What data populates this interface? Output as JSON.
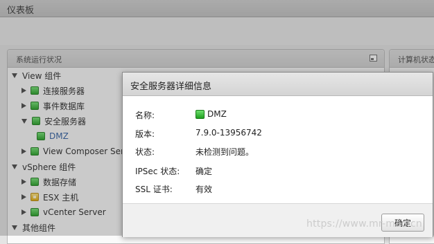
{
  "page": {
    "title": "仪表板"
  },
  "left_panel": {
    "title": "系统运行状况",
    "tree": [
      {
        "label": "View 组件",
        "level": 0,
        "expander": "down",
        "icon": null
      },
      {
        "label": "连接服务器",
        "level": 1,
        "expander": "right",
        "icon": "green-status-icon"
      },
      {
        "label": "事件数据库",
        "level": 1,
        "expander": "right",
        "icon": "green-status-icon"
      },
      {
        "label": "安全服务器",
        "level": 1,
        "expander": "down",
        "icon": "green-status-icon"
      },
      {
        "label": "DMZ",
        "level": 2,
        "expander": null,
        "icon": "green-status-icon"
      },
      {
        "label": "View Composer Serv",
        "level": 1,
        "expander": "right",
        "icon": "green-status-icon"
      },
      {
        "label": "vSphere 组件",
        "level": 0,
        "expander": "down",
        "icon": null
      },
      {
        "label": "数据存储",
        "level": 1,
        "expander": "right",
        "icon": "green-status-icon"
      },
      {
        "label": "ESX 主机",
        "level": 1,
        "expander": "right",
        "icon": "yellow-status-icon"
      },
      {
        "label": "vCenter Server",
        "level": 1,
        "expander": "right",
        "icon": "green-status-icon"
      },
      {
        "label": "其他组件",
        "level": 0,
        "expander": "down",
        "icon": null
      }
    ]
  },
  "right_panel": {
    "title": "计算机状态"
  },
  "modal": {
    "title": "安全服务器详细信息",
    "fields": {
      "name_label": "名称:",
      "name_value": "DMZ",
      "version_label": "版本:",
      "version_value": "7.9.0-13956742",
      "status_label": "状态:",
      "status_value": "未检测到问题。",
      "ipsec_label": "IPSec 状态:",
      "ipsec_value": "确定",
      "ssl_label": "SSL 证书:",
      "ssl_value": "有效"
    },
    "ok_label": "确定"
  },
  "watermark": "https://www.mr-mao.cn",
  "colors": {
    "status_green": "#2fb52f",
    "status_yellow": "#f0b400",
    "link": "#2a5aa0"
  }
}
